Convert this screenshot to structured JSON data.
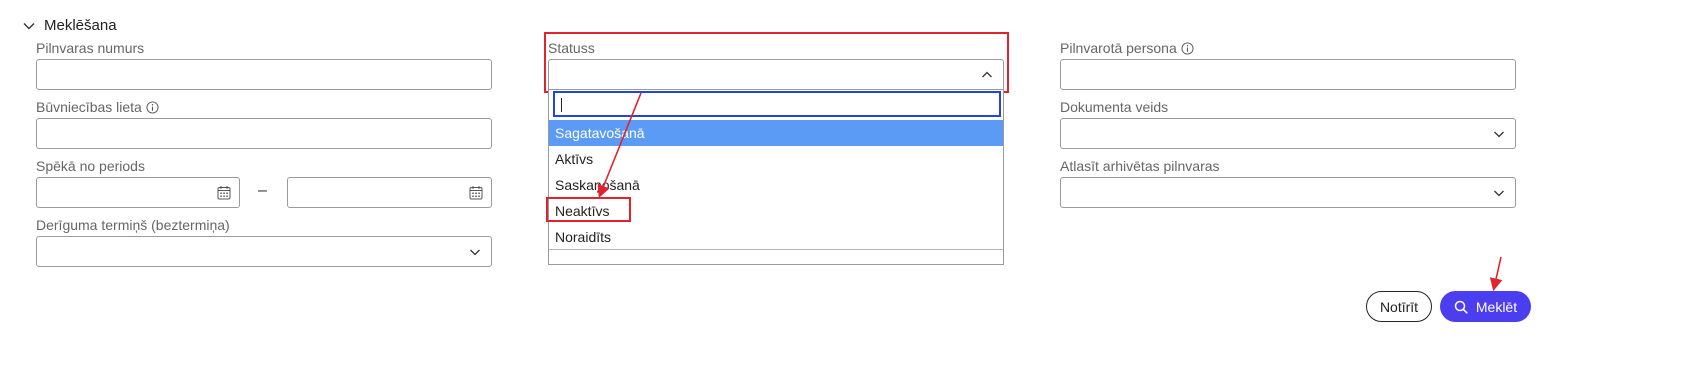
{
  "section": {
    "title": "Meklēšana"
  },
  "fields": {
    "pilnvaras_numurs": {
      "label": "Pilnvaras numurs",
      "value": ""
    },
    "buvniecibas_lieta": {
      "label": "Būvniecības lieta",
      "value": ""
    },
    "speka_no": {
      "label": "Spēkā no periods",
      "from": "",
      "to": "",
      "separator": "–"
    },
    "deriguma_termins": {
      "label": "Derīguma termiņš (beztermiņa)",
      "value": ""
    },
    "statuss": {
      "label": "Statuss",
      "value": "",
      "search_value": ""
    },
    "pilnvarota_persona": {
      "label": "Pilnvarotā persona",
      "value": ""
    },
    "dokumenta_veids": {
      "label": "Dokumenta veids",
      "value": ""
    },
    "arhivetas": {
      "label": "Atlasīt arhivētas pilnvaras",
      "value": ""
    }
  },
  "status_options": [
    {
      "label": "Sagatavošanā",
      "selected": true
    },
    {
      "label": "Aktīvs",
      "selected": false
    },
    {
      "label": "Saskaņošanā",
      "selected": false
    },
    {
      "label": "Neaktīvs",
      "selected": false
    },
    {
      "label": "Noraidīts",
      "selected": false
    }
  ],
  "buttons": {
    "clear": "Notīrīt",
    "search": "Meklēt"
  },
  "colors": {
    "primary": "#4b3df0",
    "highlight": "#5b9bf5",
    "annotation": "#e0242e",
    "focus": "#2346d6"
  }
}
